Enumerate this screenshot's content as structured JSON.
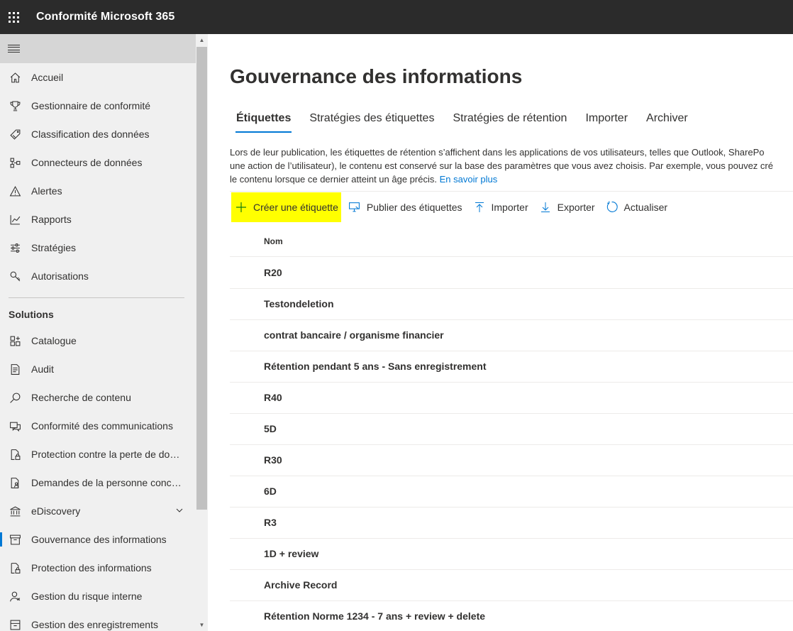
{
  "app": {
    "title": "Conformité Microsoft 365"
  },
  "sidebar": {
    "items": [
      {
        "label": "Accueil",
        "icon": "home-icon"
      },
      {
        "label": "Gestionnaire de conformité",
        "icon": "trophy-icon"
      },
      {
        "label": "Classification des données",
        "icon": "tag-icon"
      },
      {
        "label": "Connecteurs de données",
        "icon": "connector-icon"
      },
      {
        "label": "Alertes",
        "icon": "warning-icon"
      },
      {
        "label": "Rapports",
        "icon": "chart-line-icon"
      },
      {
        "label": "Stratégies",
        "icon": "sliders-icon"
      },
      {
        "label": "Autorisations",
        "icon": "key-icon"
      }
    ],
    "solutions_title": "Solutions",
    "solutions": [
      {
        "label": "Catalogue",
        "icon": "catalog-icon"
      },
      {
        "label": "Audit",
        "icon": "audit-icon"
      },
      {
        "label": "Recherche de contenu",
        "icon": "search-icon"
      },
      {
        "label": "Conformité des communications",
        "icon": "chat-icon"
      },
      {
        "label": "Protection contre la perte de don...",
        "icon": "document-lock-icon"
      },
      {
        "label": "Demandes de la personne concer...",
        "icon": "document-person-icon"
      },
      {
        "label": "eDiscovery",
        "icon": "bank-icon"
      },
      {
        "label": "Gouvernance des informations",
        "icon": "archive-icon"
      },
      {
        "label": "Protection des informations",
        "icon": "document-lock-icon"
      },
      {
        "label": "Gestion du risque interne",
        "icon": "person-icon"
      },
      {
        "label": "Gestion des enregistrements",
        "icon": "records-icon"
      }
    ],
    "active": "Gouvernance des informations"
  },
  "main": {
    "title": "Gouvernance des informations",
    "tabs": [
      {
        "label": "Étiquettes",
        "active": true
      },
      {
        "label": "Stratégies des étiquettes"
      },
      {
        "label": "Stratégies de rétention"
      },
      {
        "label": "Importer"
      },
      {
        "label": "Archiver"
      }
    ],
    "description": {
      "line1": "Lors de leur publication, les étiquettes de rétention s’affichent dans les applications de vos utilisateurs, telles que Outlook, SharePo",
      "line2": "une action de l’utilisateur), le contenu est conservé sur la base des paramètres que vous avez choisis. Par exemple, vous pouvez cré",
      "line3": "le contenu lorsque ce dernier atteint un âge précis.",
      "link": "En savoir plus"
    },
    "toolbar": {
      "create": "Créer une étiquette",
      "publish": "Publier des étiquettes",
      "import": "Importer",
      "export": "Exporter",
      "refresh": "Actualiser"
    },
    "table": {
      "column": "Nom",
      "rows": [
        "R20",
        "Testondeletion",
        "contrat bancaire / organisme financier",
        "Rétention pendant 5 ans - Sans enregistrement",
        "R40",
        "5D",
        "R30",
        "6D",
        "R3",
        "1D + review",
        "Archive Record",
        "Rétention Norme 1234 - 7 ans + review + delete"
      ]
    }
  },
  "colors": {
    "topbar": "#2b2b2b",
    "accent": "#0078d4",
    "highlight": "#ffff00"
  }
}
